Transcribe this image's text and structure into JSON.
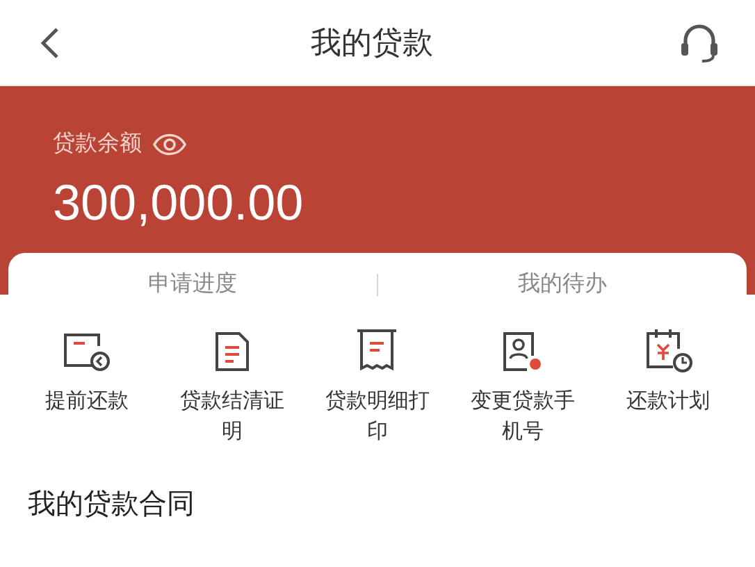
{
  "header": {
    "title": "我的贷款"
  },
  "balance": {
    "label": "贷款余额",
    "amount": "300,000.00"
  },
  "tabs": [
    {
      "label": "申请进度",
      "selected": false
    },
    {
      "label": "我的待办",
      "selected": false
    }
  ],
  "actions": [
    {
      "kind": "prepay",
      "label": "提前还款"
    },
    {
      "kind": "certificate",
      "label": "贷款结清证明"
    },
    {
      "kind": "receipt",
      "label": "贷款明细打印"
    },
    {
      "kind": "phone",
      "label": "变更贷款手机号"
    },
    {
      "kind": "plan",
      "label": "还款计划"
    }
  ],
  "section": {
    "title": "我的贷款合同"
  }
}
